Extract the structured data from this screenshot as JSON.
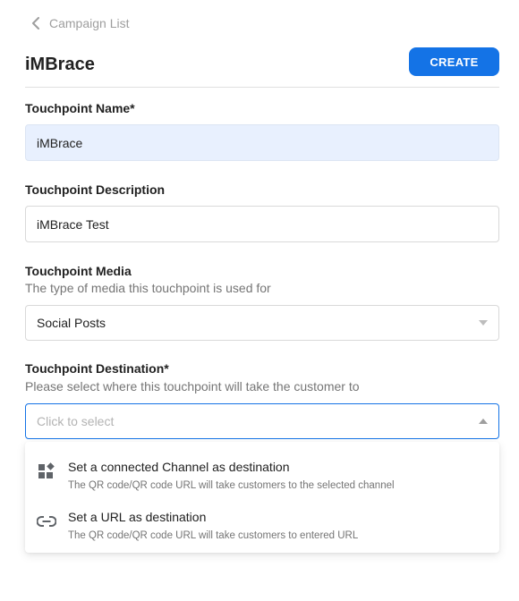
{
  "header": {
    "back_label": "Campaign List",
    "title": "iMBrace",
    "create_label": "CREATE"
  },
  "form": {
    "name": {
      "label": "Touchpoint Name*",
      "value": "iMBrace"
    },
    "description": {
      "label": "Touchpoint Description",
      "value": "iMBrace Test"
    },
    "media": {
      "label": "Touchpoint Media",
      "help": "The type of media this touchpoint is used for",
      "selected": "Social Posts"
    },
    "destination": {
      "label": "Touchpoint Destination*",
      "help": "Please select where this touchpoint will take the customer to",
      "placeholder": "Click to select",
      "options": [
        {
          "icon": "widgets-icon",
          "title": "Set a connected Channel as destination",
          "description": "The QR code/QR code URL will take customers to the selected channel"
        },
        {
          "icon": "link-icon",
          "title": "Set a URL as destination",
          "description": "The QR code/QR code URL will take customers to entered URL"
        }
      ]
    }
  },
  "colors": {
    "primary": "#1473e6",
    "filled_input_bg": "#e8f0fe",
    "muted_text": "#757575",
    "placeholder": "#b3b3b3"
  }
}
